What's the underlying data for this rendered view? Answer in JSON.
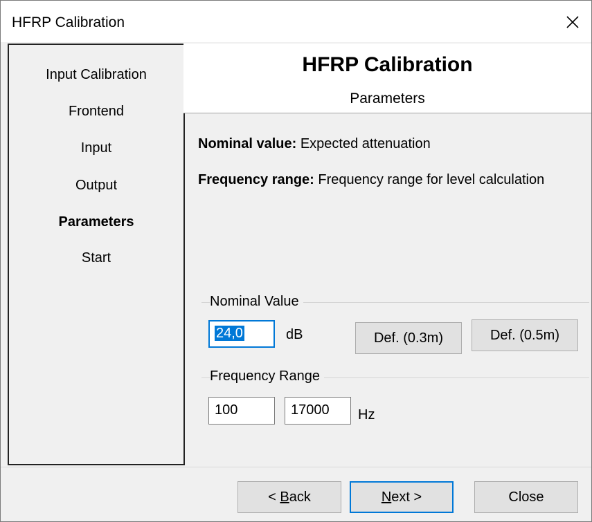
{
  "window": {
    "title": "HFRP Calibration",
    "close_label": "×"
  },
  "sidebar": {
    "items": [
      {
        "label": "Input Calibration",
        "active": false
      },
      {
        "label": "Frontend",
        "active": false
      },
      {
        "label": "Input",
        "active": false
      },
      {
        "label": "Output",
        "active": false
      },
      {
        "label": "Parameters",
        "active": true
      },
      {
        "label": "Start",
        "active": false
      }
    ]
  },
  "header": {
    "title": "HFRP Calibration",
    "subtitle": "Parameters"
  },
  "descriptions": {
    "nominal": {
      "term": "Nominal value:",
      "text": " Expected attenuation"
    },
    "frequency": {
      "term": "Frequency range:",
      "text": " Frequency range for level calculation"
    }
  },
  "nominal_group": {
    "label": "Nominal Value",
    "value": "24,0",
    "unit": "dB",
    "def03_label": "Def. (0.3m)",
    "def05_label": "Def. (0.5m)"
  },
  "frequency_group": {
    "label": "Frequency Range",
    "low": "100",
    "high": "17000",
    "unit": "Hz"
  },
  "footer": {
    "back_label_pre": "< ",
    "back_label_mnemonic": "B",
    "back_label_post": "ack",
    "next_label_mnemonic": "N",
    "next_label_post": "ext >",
    "close_label": "Close"
  },
  "colors": {
    "accent": "#0078d7",
    "background": "#f0f0f0",
    "panel": "#ffffff"
  }
}
